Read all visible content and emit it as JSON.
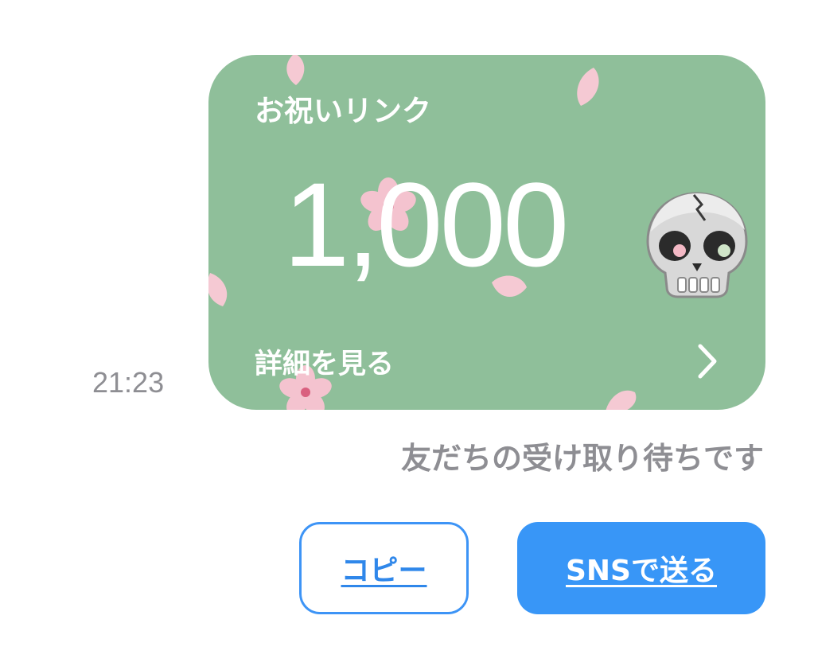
{
  "message": {
    "timestamp": "21:23",
    "status_text": "友だちの受け取り待ちです"
  },
  "card": {
    "title": "お祝いリンク",
    "amount": "1,000",
    "details_label": "詳細を見る",
    "background_color": "#8fbf9a",
    "decoration": "cherry-blossom",
    "emoji_icon": "skull-icon",
    "chevron_icon": "chevron-right-icon"
  },
  "actions": {
    "copy_label": "コピー",
    "share_label": "SNSで送る",
    "accent_color": "#3896f7"
  }
}
